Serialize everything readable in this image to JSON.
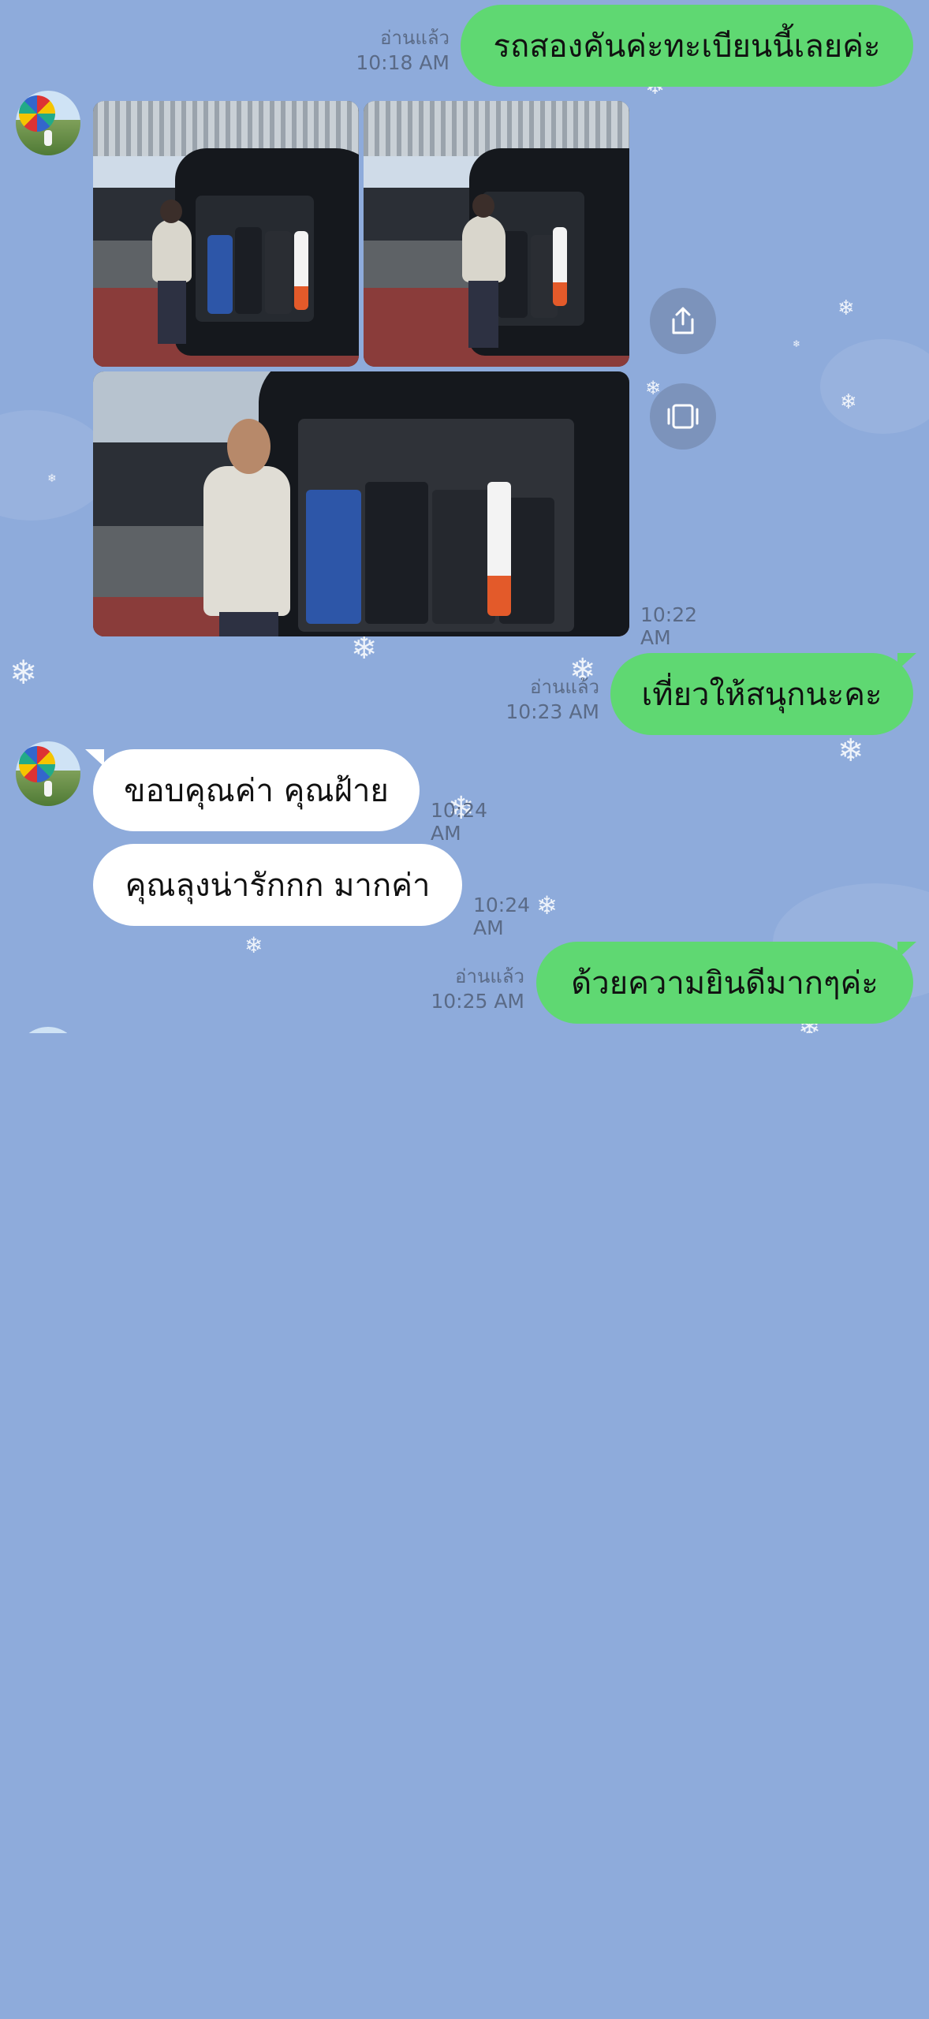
{
  "messages": [
    {
      "id": "m1",
      "direction": "outgoing",
      "read_label": "อ่านแล้ว",
      "time": "10:18 AM",
      "text": "รถสองคันค่ะทะเบียนนี้เลยค่ะ"
    },
    {
      "id": "m2",
      "direction": "incoming",
      "type": "photos",
      "photo_count": 3,
      "time": "10:22 AM"
    },
    {
      "id": "m3",
      "direction": "outgoing",
      "read_label": "อ่านแล้ว",
      "time": "10:23 AM",
      "text": "เที่ยวให้สนุกนะคะ"
    },
    {
      "id": "m4",
      "direction": "incoming",
      "time": "10:24 AM",
      "text": "ขอบคุณค่า คุณฝ้าย"
    },
    {
      "id": "m5",
      "direction": "incoming",
      "time": "10:24 AM",
      "text": "คุณลุงน่ารักกก มากค่า"
    },
    {
      "id": "m6",
      "direction": "outgoing",
      "read_label": "อ่านแล้ว",
      "time": "10:25 AM",
      "text": "ด้วยความยินดีมากๆค่ะ"
    }
  ],
  "photo_actions": {
    "share_icon": "share-icon",
    "collage_icon": "collage-view-icon"
  },
  "colors": {
    "background": "#8eabdb",
    "outgoing_bubble": "#5fd872",
    "incoming_bubble": "#ffffff",
    "meta_text": "#5a6a86"
  }
}
